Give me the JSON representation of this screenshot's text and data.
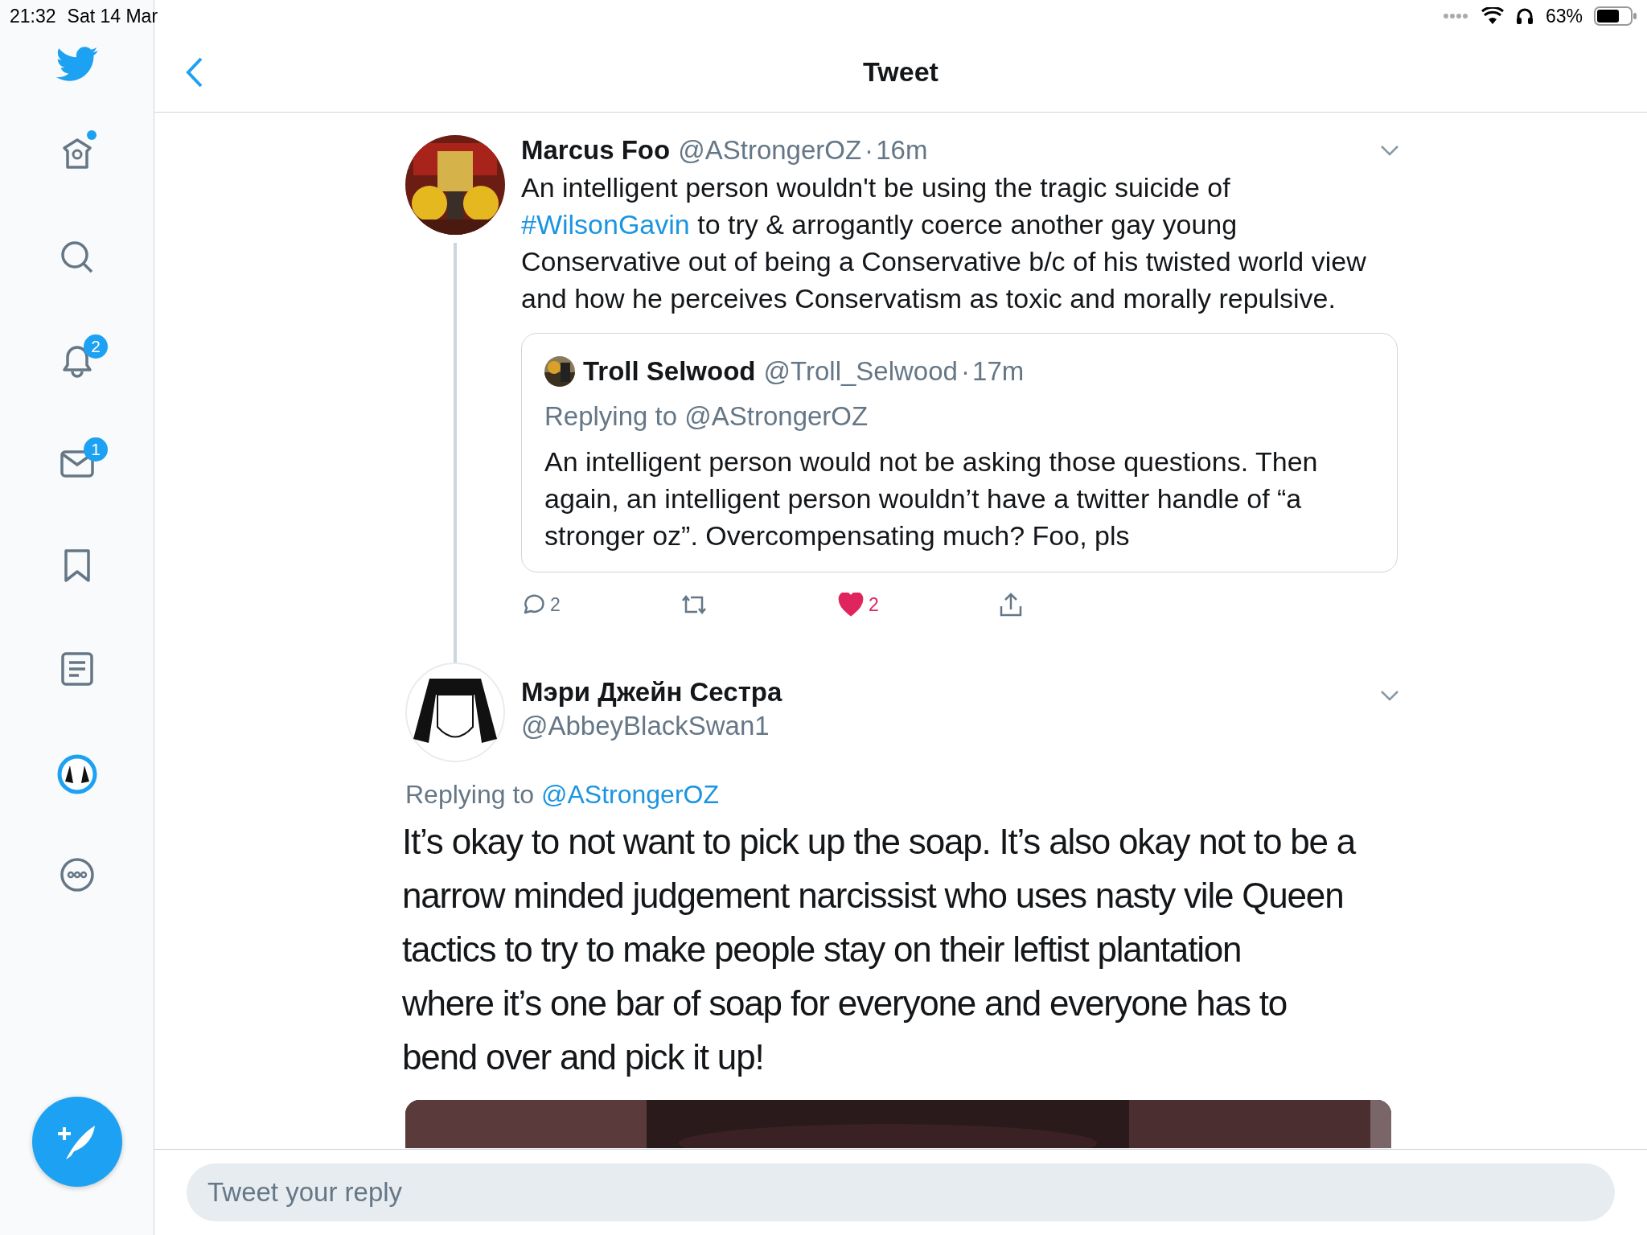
{
  "status_bar": {
    "time": "21:32",
    "date": "Sat 14 Mar",
    "battery": "63%"
  },
  "sidebar": {
    "items": [
      {
        "kind": "home",
        "dot": true
      },
      {
        "kind": "search"
      },
      {
        "kind": "bell",
        "badge": "2"
      },
      {
        "kind": "mail",
        "badge": "1"
      },
      {
        "kind": "bookmark"
      },
      {
        "kind": "list"
      },
      {
        "kind": "profile"
      },
      {
        "kind": "more"
      }
    ]
  },
  "header": {
    "title": "Tweet"
  },
  "main_tweet": {
    "name": "Marcus Foo",
    "handle": "@AStrongerOZ",
    "time": "· 16m",
    "text": [
      {
        "kind": "plain",
        "text": "An intelligent person wouldn't be using the tragic suicide of\n"
      },
      {
        "kind": "hashtag",
        "text": "#WilsonGavin"
      },
      {
        "kind": "plain",
        "text": " to try & arrogantly coerce another gay young\nConservative out of being a Conservative b/c of his twisted world view\nand how he perceives Conservatism as toxic and morally repulsive."
      }
    ],
    "quote": {
      "name": "Troll Selwood",
      "handle": "@Troll_Selwood",
      "time": "· 17m",
      "replying": "Replying to @AStrongerOZ",
      "text": "An intelligent person would not be asking those questions. Then\nagain, an intelligent person wouldn’t have a twitter handle of “a\nstronger oz”. Overcompensating much? Foo, pls"
    },
    "replies": "2",
    "likes": "2",
    "liked": true
  },
  "reply_tweet": {
    "name": "Мэри Джейн Сестра",
    "handle": "@AbbeyBlackSwan1",
    "replying_label": "Replying to",
    "replying_handle": "@AStrongerOZ",
    "text": "It’s okay to not want to pick up the soap. It’s also okay not to be a\nnarrow minded judgement narcissist who uses nasty vile Queen\ntactics to try to make people stay on their leftist plantation\nwhere it’s one bar of soap for everyone and everyone has to\nbend over and pick it up!"
  },
  "reply_bar": {
    "placeholder": "Tweet your reply"
  }
}
